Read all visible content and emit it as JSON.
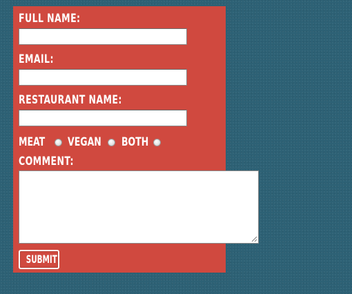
{
  "form": {
    "full_name_label": "FULL NAME:",
    "full_name_value": "",
    "email_label": "EMAIL:",
    "email_value": "",
    "restaurant_label": "RESTAURANT NAME:",
    "restaurant_value": "",
    "diet_options": [
      {
        "label": "MEAT",
        "selected": false
      },
      {
        "label": "VEGAN",
        "selected": false
      },
      {
        "label": "BOTH",
        "selected": false
      }
    ],
    "comment_label": "COMMENT:",
    "comment_value": "",
    "submit_label": "SUBMIT"
  },
  "colors": {
    "background": "#2d6175",
    "panel": "#d0493f",
    "text": "#ffffff"
  }
}
